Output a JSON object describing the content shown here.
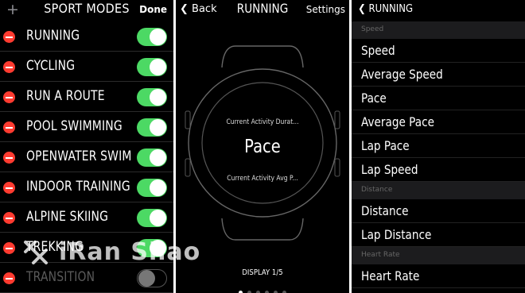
{
  "sport_modes": {
    "title": "SPORT MODES",
    "plus_icon": "+",
    "done_label": "Done",
    "items": [
      {
        "label": "RUNNING",
        "enabled": true
      },
      {
        "label": "CYCLING",
        "enabled": true
      },
      {
        "label": "RUN A ROUTE",
        "enabled": true
      },
      {
        "label": "POOL SWIMMING",
        "enabled": true
      },
      {
        "label": "OPENWATER SWIM",
        "enabled": true
      },
      {
        "label": "INDOOR TRAINING",
        "enabled": true
      },
      {
        "label": "ALPINE SKIING",
        "enabled": true
      },
      {
        "label": "TREKKING",
        "enabled": true
      },
      {
        "label": "TRANSITION",
        "enabled": false
      }
    ]
  },
  "running": {
    "back_label": "Back",
    "title": "RUNNING",
    "settings_label": "Settings",
    "watch": {
      "line_top": "Current Activity Durat...",
      "main": "Pace",
      "line_bottom": "Current Activity Avg P..."
    },
    "display_label": "DISPLAY 1/5",
    "page_count": 6,
    "active_page": 0
  },
  "field_list": {
    "back_label": "RUNNING",
    "sections": [
      {
        "header": "Speed",
        "items": [
          "Speed",
          "Average Speed",
          "Pace",
          "Average Pace",
          "Lap Pace",
          "Lap Speed"
        ]
      },
      {
        "header": "Distance",
        "items": [
          "Distance",
          "Lap Distance"
        ]
      },
      {
        "header": "Heart Rate",
        "items": [
          "Heart Rate"
        ]
      }
    ]
  },
  "watermark": {
    "text": "iRan Shao"
  },
  "colors": {
    "toggle_on": "#4cd964",
    "remove": "#ff3b30",
    "background": "#000000"
  }
}
